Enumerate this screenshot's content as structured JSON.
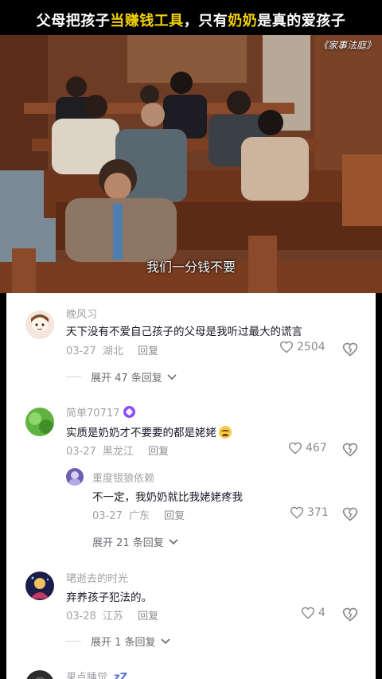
{
  "header": {
    "headline_pre": "父母把孩子",
    "headline_hl1": "当赚钱工具",
    "headline_mid": "，只有",
    "headline_hl2": "奶奶",
    "headline_post": "是真的爱孩子",
    "show_title": "《家事法庭》"
  },
  "video": {
    "subtitle": "我们一分钱不要"
  },
  "colors": {
    "headline_highlight": "#f3d100",
    "vip_badge": "#8b4dff",
    "text_primary": "#161823",
    "text_muted": "#a2a2a8"
  },
  "comments": [
    {
      "username": "晚风习",
      "text": "天下没有不爱自己孩子的父母是我听过最大的谎言",
      "date": "03-27",
      "location": "湖北",
      "reply_label": "回复",
      "likes": "2504",
      "expand": "展开 47 条回复"
    },
    {
      "username": "简单70717",
      "text": "实质是奶奶才不要要的都是姥姥",
      "emoji": "crying-face",
      "date": "03-27",
      "location": "黑龙江",
      "reply_label": "回复",
      "likes": "467",
      "replies": [
        {
          "username": "重度银狼依赖",
          "text": "不一定，我奶奶就比我姥姥疼我",
          "date": "03-27",
          "location": "广东",
          "reply_label": "回复",
          "likes": "371"
        }
      ],
      "expand": "展开 21 条回复"
    },
    {
      "username": "珺逝去的时光",
      "text": "弃养孩子犯法的。",
      "date": "03-28",
      "location": "江苏",
      "reply_label": "回复",
      "likes": "4",
      "expand": "展开 1 条回复"
    },
    {
      "username": "果点睡觉",
      "suffix": "zZ"
    }
  ]
}
